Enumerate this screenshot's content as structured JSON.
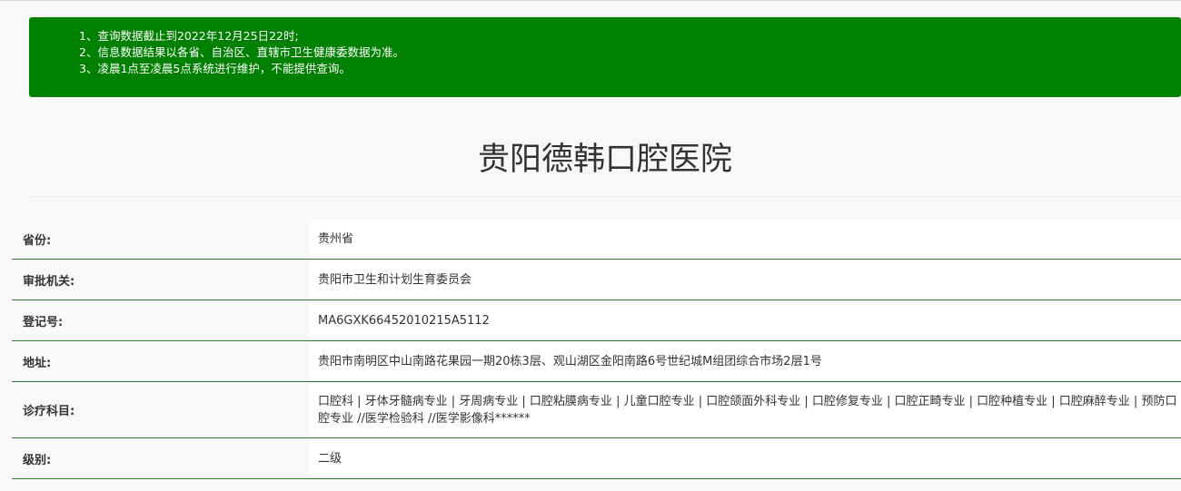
{
  "notice": {
    "lines": [
      "1、查询数据截止到2022年12月25日22时;",
      "2、信息数据结果以各省、自治区、直辖市卫生健康委数据为准。",
      "3、凌晨1点至凌晨5点系统进行维护，不能提供查询。"
    ]
  },
  "title": "贵阳德韩口腔医院",
  "rows": [
    {
      "key": "省份:",
      "value": "贵州省"
    },
    {
      "key": "审批机关:",
      "value": "贵阳市卫生和计划生育委员会"
    },
    {
      "key": "登记号:",
      "value": "MA6GXK66452010215A5112"
    },
    {
      "key": "地址:",
      "value": "贵阳市南明区中山南路花果园一期20栋3层、观山湖区金阳南路6号世纪城M组团综合市场2层1号"
    },
    {
      "key": "诊疗科目:",
      "value": "口腔科 | 牙体牙髓病专业 | 牙周病专业 | 口腔粘膜病专业 | 儿童口腔专业 | 口腔颌面外科专业 | 口腔修复专业 | 口腔正畸专业 | 口腔种植专业 | 口腔麻醉专业 | 预防口腔专业 //医学检验科 //医学影像科******"
    },
    {
      "key": "级别:",
      "value": "二级"
    }
  ]
}
